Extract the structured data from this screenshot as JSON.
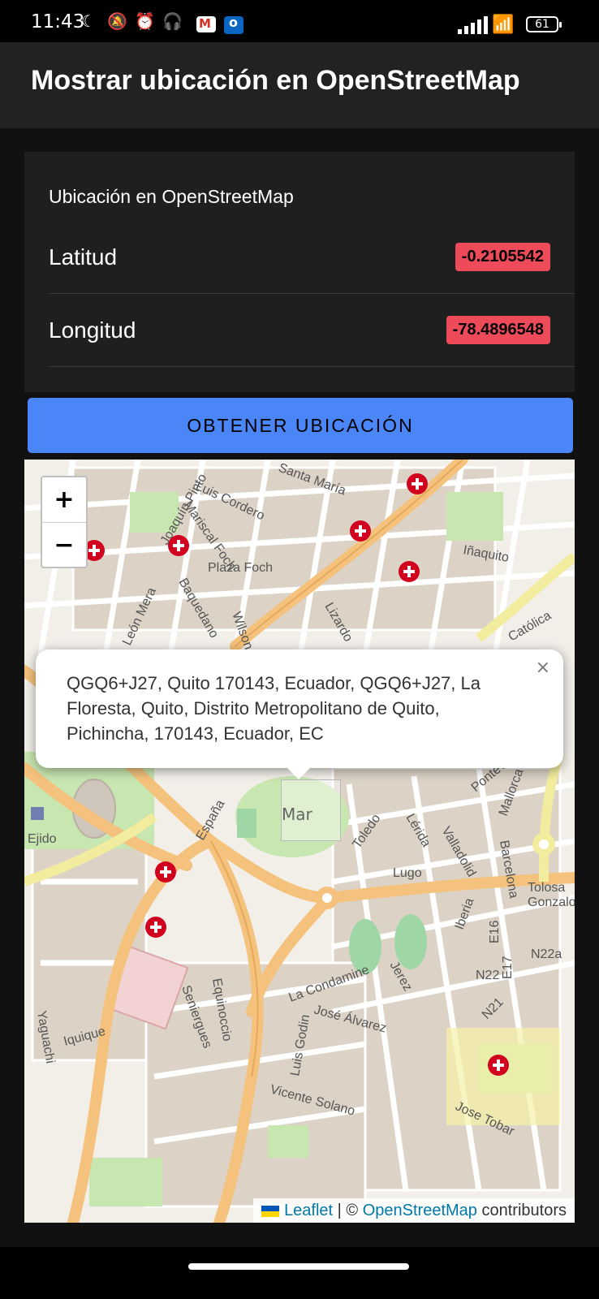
{
  "status": {
    "time": "11:43",
    "battery": "61"
  },
  "appbar": {
    "title": "Mostrar ubicación en OpenStreetMap"
  },
  "card": {
    "heading": "Ubicación en OpenStreetMap",
    "rows": [
      {
        "label": "Latitud",
        "value": "-0.2105542"
      },
      {
        "label": "Longitud",
        "value": "-78.4896548"
      }
    ]
  },
  "button": {
    "label": "OBTENER UBICACIÓN"
  },
  "map": {
    "zoom_in": "+",
    "zoom_out": "−",
    "popup_text": "QGQ6+J27, Quito 170143, Ecuador, QGQ6+J27, La Floresta, Quito, Distrito Metropolitano de Quito, Pichincha, 170143, Ecuador, EC",
    "popup_close": "×",
    "marker_alt": "Mar",
    "attribution": {
      "leaflet": "Leaflet",
      "sep": " | © ",
      "osm": "OpenStreetMap",
      "tail": " contributors"
    },
    "labels": {
      "plaza": "Plaza Foch",
      "inaquito": "Iñaquito",
      "ejido": "Ejido",
      "toledo": "Toledo",
      "lugo": "Lugo",
      "condamine": "La Condamine",
      "jose_alvarez": "José Álvarez",
      "vicente_solano": "Vicente Solano",
      "luis_cordero": "Luis Cordero",
      "santa_maria": "Santa María",
      "mariscal_foch": "Mariscal Foch",
      "joaquin_pinto": "Joaquín Pinto",
      "leon_mera": "León Mera",
      "wilson": "Wilson",
      "lizardo": "Lizardo",
      "baquedano": "Baquedano",
      "catolica": "Católica",
      "espana": "España",
      "lerida": "Lérida",
      "valladolid": "Valladolid",
      "barcelona": "Barcelona",
      "tolosa": "Tolosa",
      "gonzalo": "Gonzalo de",
      "iberia": "Iberia",
      "jerez": "Jerez",
      "jose_tobar": "Jose Tobar",
      "equinoccio": "Equinoccio",
      "seniergues": "Seniergues",
      "yaguachi": "Yaguachi",
      "iquique": "Iquique",
      "pontevedra": "Pontevedra",
      "mallorca": "Mallorca",
      "luis_godin": "Luis Godin",
      "n22": "N22",
      "n21": "N21",
      "e16": "E16",
      "e17": "E17",
      "n22a": "N22a"
    }
  }
}
